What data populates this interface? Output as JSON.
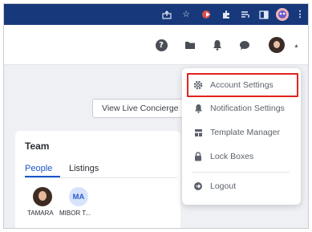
{
  "browser": {
    "toolbar_icons": [
      "share-icon",
      "star-icon",
      "extension-arrow-icon",
      "puzzle-icon",
      "reading-list-icon",
      "side-panel-icon",
      "profile-avatar-icon",
      "kebab-menu-icon"
    ],
    "accent": "#17387a"
  },
  "header": {
    "icons": [
      "help-icon",
      "folder-icon",
      "bell-icon",
      "chat-icon",
      "user-avatar-icon",
      "chevron-down-icon"
    ]
  },
  "concierge": {
    "label": "View Live Concierge"
  },
  "team": {
    "title": "Team",
    "tabs": [
      {
        "label": "People",
        "active": true
      },
      {
        "label": "Listings",
        "active": false
      }
    ],
    "members": [
      {
        "name": "TAMARA",
        "initials": ""
      },
      {
        "name": "MIBOR T...",
        "initials": "MA"
      }
    ],
    "accent": "#1a56c9"
  },
  "menu": {
    "items": [
      {
        "label": "Account Settings",
        "icon": "gear-icon",
        "highlighted": true
      },
      {
        "label": "Notification Settings",
        "icon": "bell-icon"
      },
      {
        "label": "Template Manager",
        "icon": "template-icon"
      },
      {
        "label": "Lock Boxes",
        "icon": "lock-icon"
      },
      {
        "label": "Logout",
        "icon": "logout-icon"
      }
    ],
    "highlight_color": "#e2221f"
  }
}
